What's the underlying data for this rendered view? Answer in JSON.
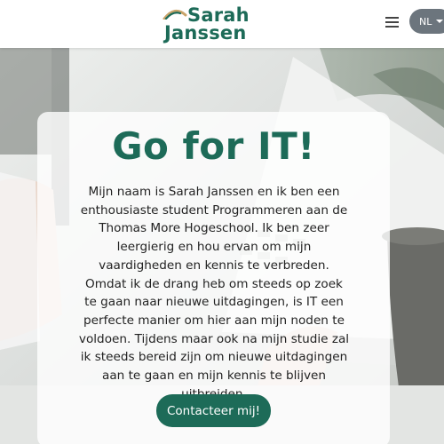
{
  "brand": {
    "first_name": "Sarah",
    "last_name": "Janssen",
    "accent_color": "#1d6b58",
    "arc_color": "#c9a46a"
  },
  "nav": {
    "menu_icon": "hamburger-icon",
    "language": {
      "selected": "NL",
      "icon": "caret-down-icon"
    }
  },
  "hero": {
    "background": "photo of hands typing on a laptop with a coffee mug",
    "title": "Go for IT!",
    "intro": "Mijn naam is Sarah Janssen en ik ben een enthousiaste student Programmeren aan de Thomas More Hogeschool. Ik ben zeer leergierig en hou ervan om mijn vaardigheden en kennis te verbreden. Omdat ik de drang heb om steeds op zoek te gaan naar nieuwe uitdagingen, is IT een perfecte manier om hier aan mijn noden te voldoen. Tijdens maar ook na mijn studie zal ik steeds bereid zijn om nieuwe uitdagingen aan te gaan en mijn kennis te blijven uitbreiden.",
    "cta_label": "Contacteer mij!"
  }
}
